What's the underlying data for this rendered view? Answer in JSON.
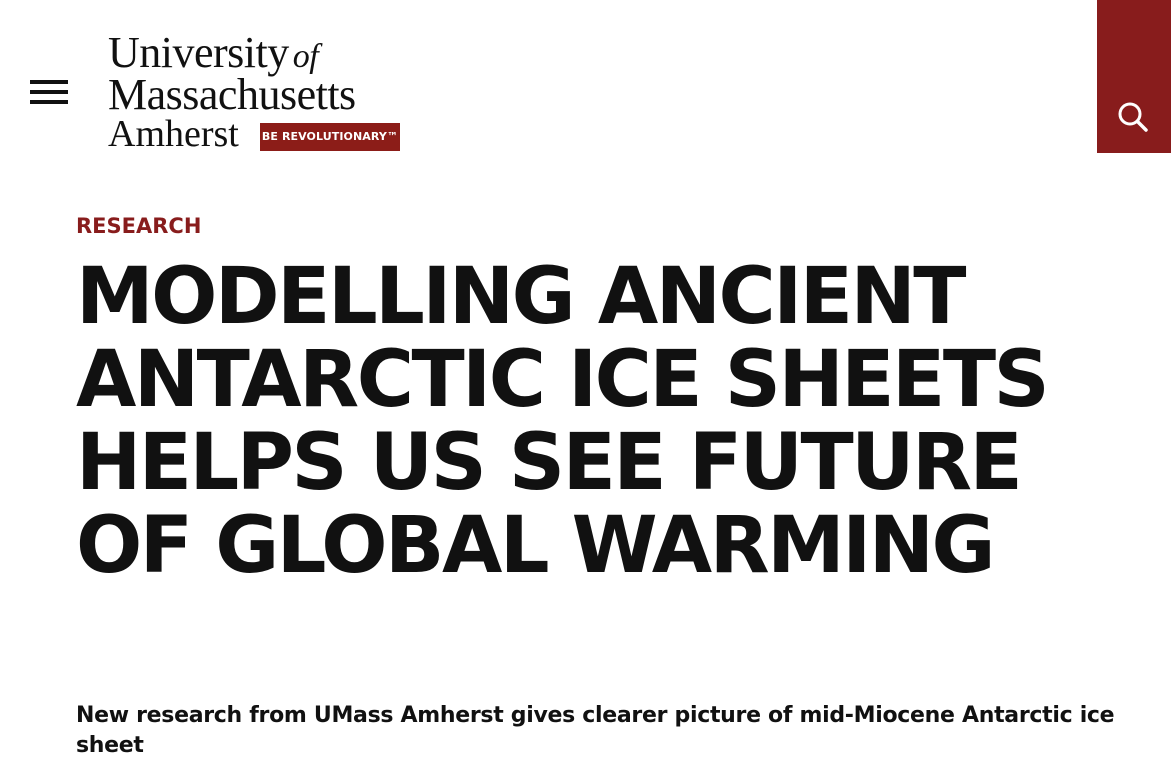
{
  "header": {
    "logo": {
      "line1": "University",
      "line1_of": "of",
      "line2": "Massachusetts",
      "line3": "Amherst",
      "tagline": "BE REVOLUTIONARY™"
    },
    "menu_icon": "hamburger-menu-icon",
    "search_icon": "search-icon"
  },
  "article": {
    "category": "RESEARCH",
    "headline": "MODELLING ANCIENT ANTARCTIC ICE SHEETS HELPS US SEE FUTURE OF GLOBAL WARMING",
    "subhead": "New research from UMass Amherst gives clearer picture of mid-Miocene Antarctic ice sheet"
  },
  "colors": {
    "brand_maroon": "#881c1c",
    "text": "#111111",
    "background": "#ffffff"
  }
}
